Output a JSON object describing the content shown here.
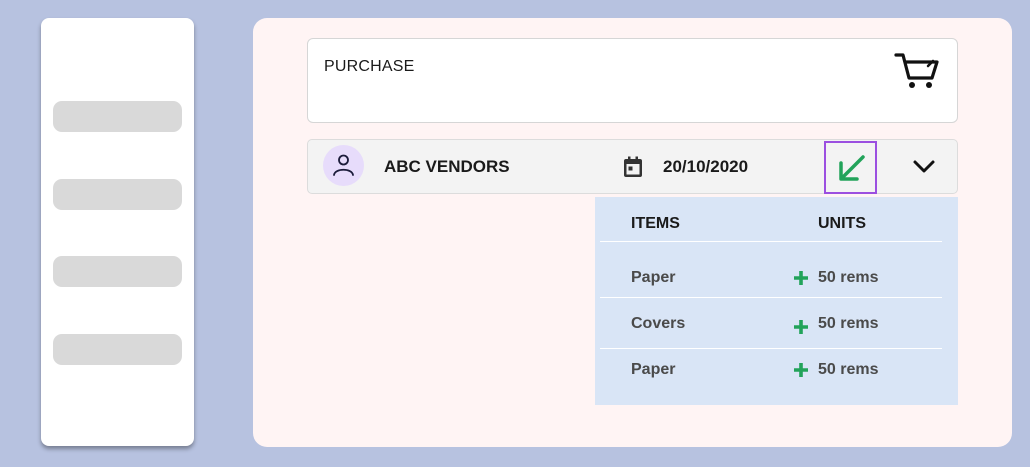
{
  "sidebar": {
    "items": [
      "",
      "",
      "",
      ""
    ]
  },
  "purchase": {
    "title": "PURCHASE",
    "cart_icon": "cart-icon"
  },
  "order": {
    "vendor": "ABC VENDORS",
    "date": "20/10/2020",
    "icons": [
      "user-icon",
      "calendar-icon",
      "arrow-down-left-icon",
      "chevron-down-icon"
    ]
  },
  "items_table": {
    "headers": {
      "items": "ITEMS",
      "units": "UNITS"
    },
    "rows": [
      {
        "item": "Paper",
        "units": "50 rems"
      },
      {
        "item": "Covers",
        "units": "50 rems"
      },
      {
        "item": "Paper",
        "units": "50 rems"
      }
    ]
  },
  "colors": {
    "background": "#b7c2e0",
    "panel": "#d9e5f6",
    "accent_green": "#22a35a",
    "highlight_purple": "#9b4fe0"
  }
}
